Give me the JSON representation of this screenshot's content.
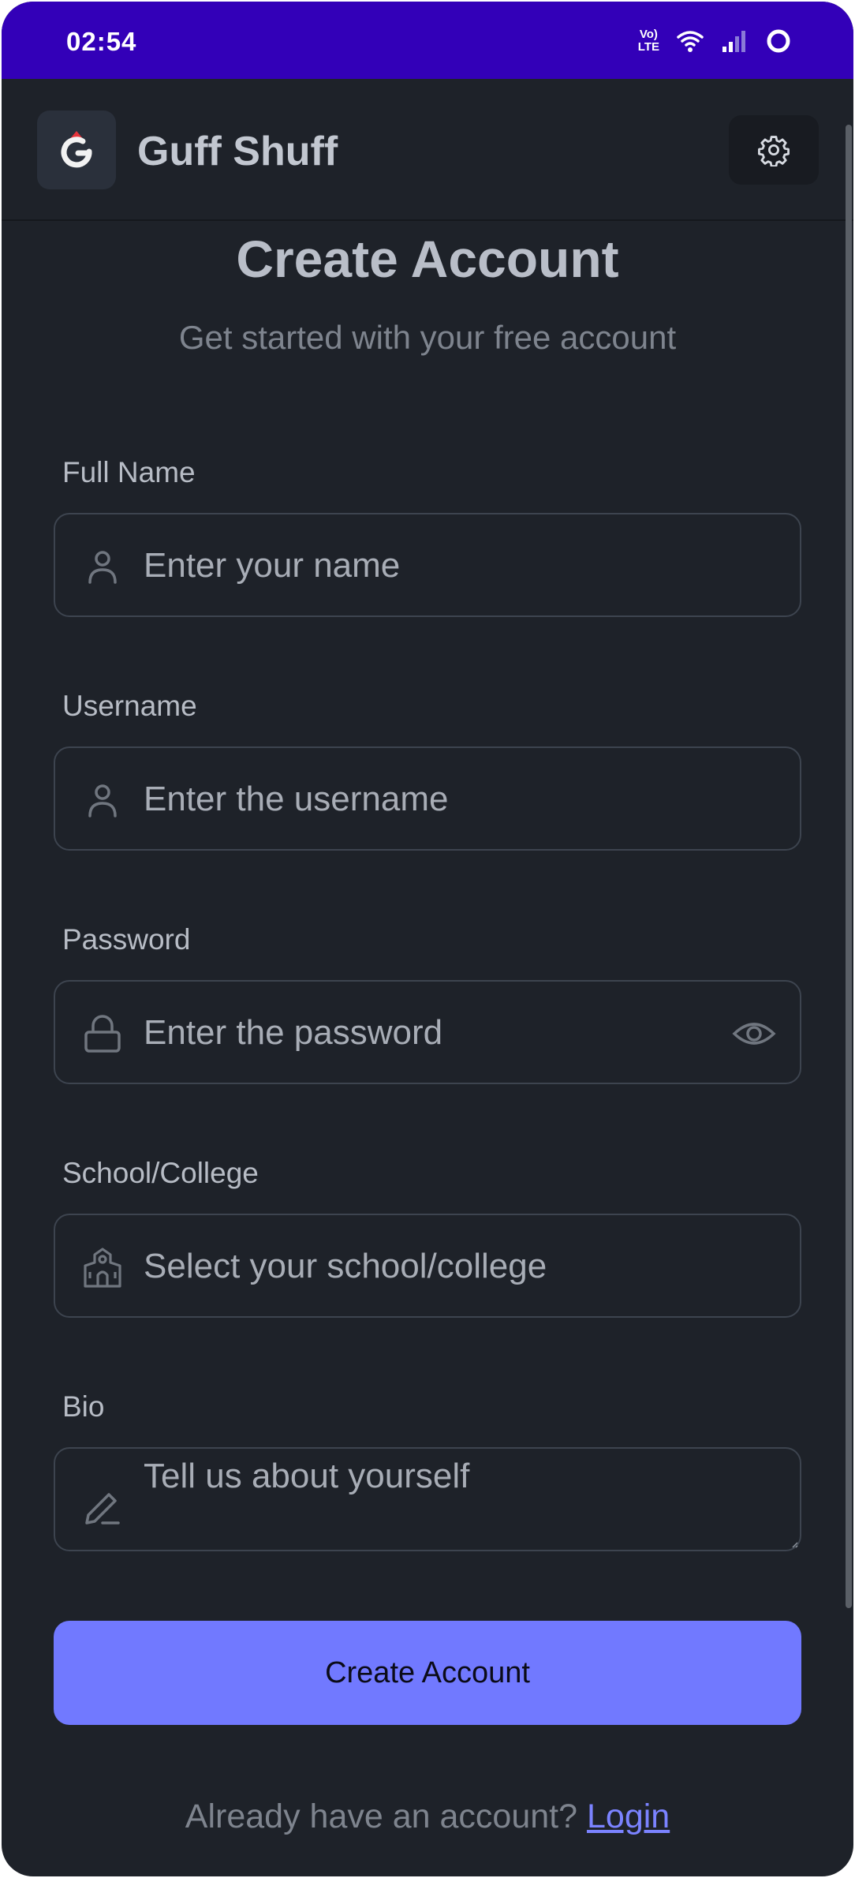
{
  "status_bar": {
    "time": "02:54",
    "volte_top": "Vo)",
    "volte_bottom": "LTE",
    "icons": [
      "volte-icon",
      "wifi-icon",
      "signal-icon",
      "battery-ring-icon"
    ]
  },
  "app_bar": {
    "logo_letter": "G",
    "title": "Guff Shuff",
    "settings_icon": "gear-icon"
  },
  "header": {
    "title": "Create Account",
    "subtitle": "Get started with your free account"
  },
  "form": {
    "fields": [
      {
        "label": "Full Name",
        "placeholder": "Enter your name",
        "icon": "user-icon"
      },
      {
        "label": "Username",
        "placeholder": "Enter the username",
        "icon": "user-icon"
      },
      {
        "label": "Password",
        "placeholder": "Enter the password",
        "icon": "lock-icon",
        "trailing_icon": "eye-icon"
      },
      {
        "label": "School/College",
        "placeholder": "Select your school/college",
        "icon": "school-icon"
      },
      {
        "label": "Bio",
        "placeholder": "Tell us about yourself",
        "icon": "pencil-icon"
      }
    ],
    "submit_label": "Create Account"
  },
  "footer": {
    "prompt": "Already have an account?",
    "link_label": "Login"
  },
  "colors": {
    "status_bar": "#3300b8",
    "background": "#1e2229",
    "accent": "#7179ff",
    "field_border": "#3d444f"
  }
}
